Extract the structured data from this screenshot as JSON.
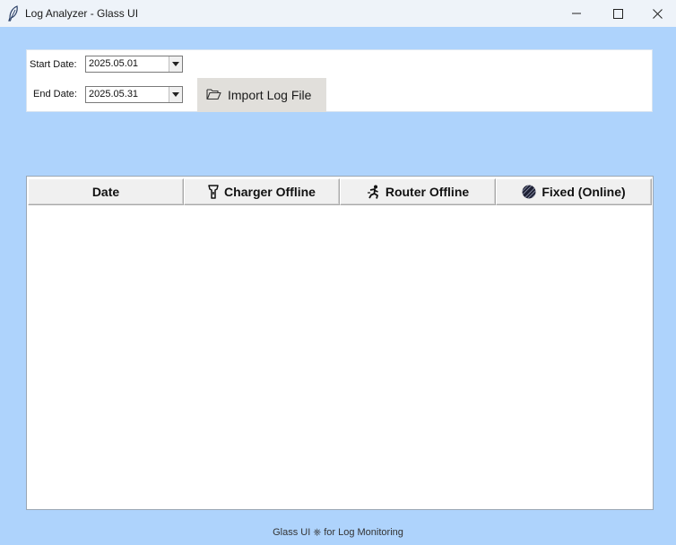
{
  "window": {
    "title": "Log Analyzer - Glass UI",
    "icon": "feather-icon"
  },
  "controls": {
    "start_date_label": "Start Date:",
    "start_date_value": "2025.05.01",
    "end_date_label": "End Date:",
    "end_date_value": "2025.05.31",
    "import_button_label": "Import Log File",
    "import_button_icon": "folder-open-icon"
  },
  "table": {
    "columns": [
      {
        "label": "Date",
        "icon": ""
      },
      {
        "label": "Charger Offline",
        "icon": "flashlight-icon"
      },
      {
        "label": "Router Offline",
        "icon": "running-person-icon"
      },
      {
        "label": "Fixed (Online)",
        "icon": "globe-icon"
      }
    ],
    "rows": []
  },
  "footer": {
    "text": "Glass UI ⎈ for Log Monitoring"
  },
  "colors": {
    "background": "#aed3fc",
    "panel": "#ffffff",
    "button": "#e1dfdb"
  }
}
